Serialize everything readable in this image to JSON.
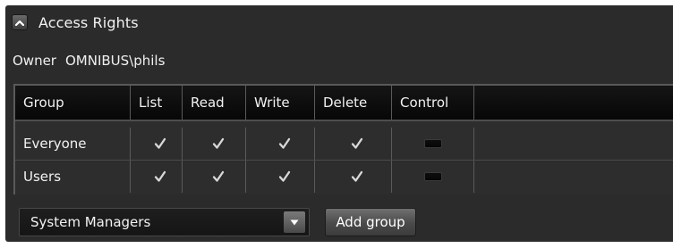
{
  "section": {
    "title": "Access Rights",
    "collapse_icon": "chevron-up-icon"
  },
  "owner": {
    "label": "Owner",
    "value": "OMNIBUS\\phils"
  },
  "table": {
    "columns": [
      "Group",
      "List",
      "Read",
      "Write",
      "Delete",
      "Control"
    ],
    "rows": [
      {
        "group": "Everyone",
        "permissions": {
          "list": true,
          "read": true,
          "write": true,
          "delete": true,
          "control": false
        }
      },
      {
        "group": "Users",
        "permissions": {
          "list": true,
          "read": true,
          "write": true,
          "delete": true,
          "control": false
        }
      }
    ]
  },
  "add_group": {
    "selected_group": "System Managers",
    "button_label": "Add group",
    "dropdown_icon": "chevron-down-icon"
  },
  "colors": {
    "panel_bg": "#2b2b2b",
    "header_bg": "#0b0b0b",
    "text": "#f2f2f2",
    "check": "#d8d8d8"
  }
}
